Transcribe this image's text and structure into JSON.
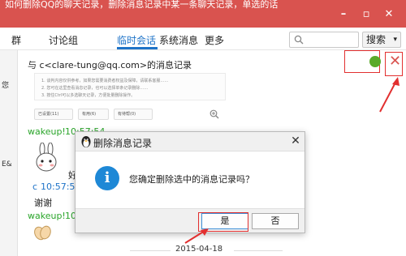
{
  "window": {
    "title_fragment": "如何删除QQ的聊天记录，删除消息记录中某一条聊天记录，单选的话"
  },
  "window_controls": {
    "minimize": "–",
    "restore": "▫",
    "close": "✕"
  },
  "nav": {
    "items": [
      "群",
      "讨论组",
      "临时会话",
      "系统消息",
      "更多"
    ],
    "active_index": 2,
    "search_placeholder": "",
    "search_button": "搜索",
    "search_caret": "▾"
  },
  "left_strip": {
    "texts": [
      "您",
      "E&"
    ]
  },
  "record": {
    "header": "与 c<clare-tung@qq.com>的消息记录",
    "preview_lines": [
      "1. 谈判内容仅供参考，如果您需要消费者权益及保障，请联系客服……",
      "2. 您可在这里查看消息记录，也可以选择单条记录删除……",
      "3. 按住Ctrl可以多选聊天记录，方便批量删除操作。"
    ],
    "pills": [
      "已设置(11)",
      "有用(6)",
      "有待帮(0)"
    ]
  },
  "chat": {
    "line1_name": "wakeup!",
    "line1_time": "10:57:54",
    "line1_text": "好",
    "line2_prefix": "c",
    "line2_time": "10:57:54",
    "line2_text": "谢谢",
    "line3_name": "wakeup!",
    "line3_time": "10",
    "date": "2015-04-18"
  },
  "dialog": {
    "title": "删除消息记录",
    "close": "✕",
    "icon_glyph": "i",
    "message": "您确定删除选中的消息记录吗？",
    "yes": "是",
    "no": "否"
  },
  "colors": {
    "accent": "#1e73c8",
    "title_bar": "#d9534f",
    "highlight_red": "#e23030",
    "name_green": "#2aa52a"
  }
}
